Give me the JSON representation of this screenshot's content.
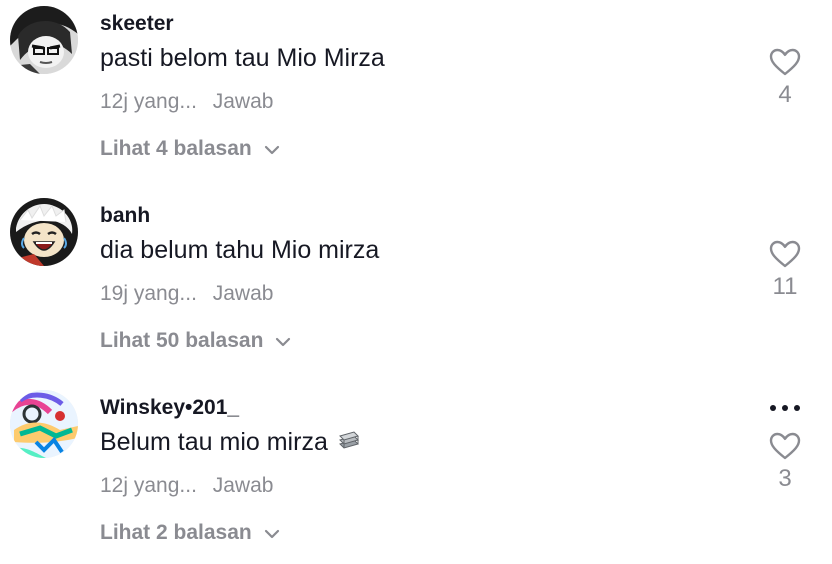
{
  "comments": [
    {
      "username": "skeeter",
      "text": "pasti belom tau Mio Mirza",
      "time": "12j yang...",
      "reply_label": "Jawab",
      "view_replies": "Lihat 4 balasan",
      "likes": "4",
      "avatar_icon": "manga-character-avatar",
      "heart_icon": "heart-outline-icon"
    },
    {
      "username": "banh",
      "text": "dia belum tahu Mio mirza",
      "time": "19j yang...",
      "reply_label": "Jawab",
      "view_replies": "Lihat 50 balasan",
      "likes": "11",
      "avatar_icon": "laughing-character-avatar",
      "heart_icon": "heart-outline-icon"
    },
    {
      "username": "Winskey•201_",
      "text": "Belum tau mio mirza",
      "time": "12j yang...",
      "reply_label": "Jawab",
      "view_replies": "Lihat 2 balasan",
      "likes": "3",
      "avatar_icon": "colorful-abstract-avatar",
      "heart_icon": "heart-outline-icon",
      "more_icon": "more-options-icon",
      "emoji_icon": "money-stack-emoji"
    }
  ],
  "colors": {
    "text_primary": "#161823",
    "text_secondary": "#8a8b91"
  }
}
